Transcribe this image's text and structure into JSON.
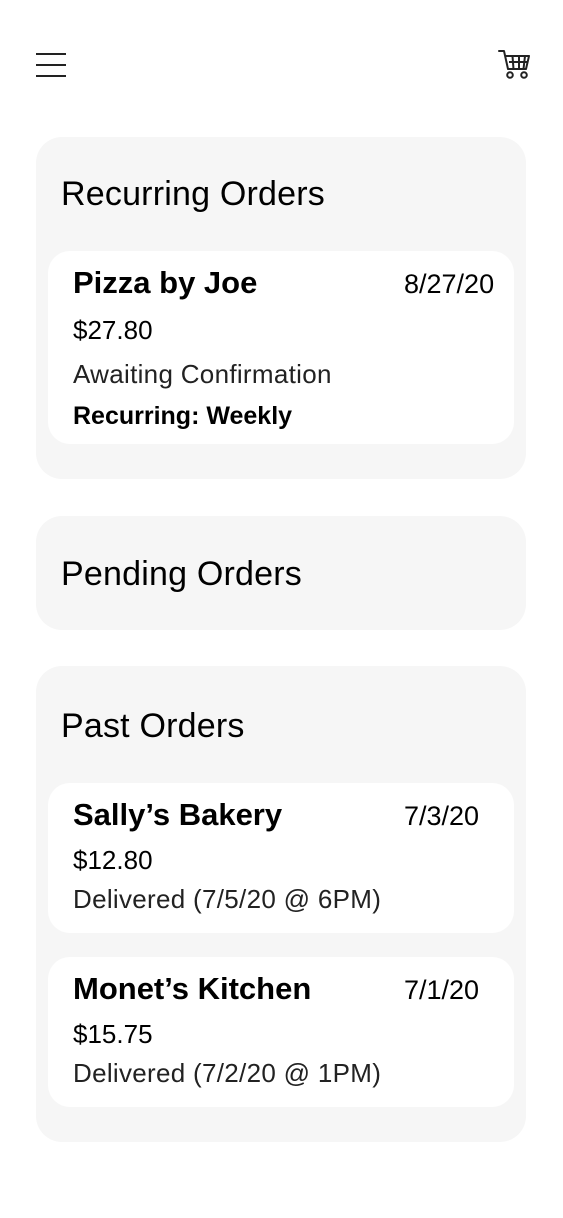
{
  "header": {
    "menu_icon": "hamburger-menu-icon",
    "cart_icon": "shopping-cart-icon"
  },
  "recurring": {
    "title": "Recurring Orders",
    "orders": [
      {
        "name": "Pizza by Joe",
        "date": "8/27/20",
        "price": "$27.80",
        "status": "Awaiting Confirmation",
        "recurrence": "Recurring: Weekly"
      }
    ]
  },
  "pending": {
    "title": "Pending Orders"
  },
  "past": {
    "title": "Past Orders",
    "orders": [
      {
        "name": "Sally’s Bakery",
        "date": "7/3/20",
        "price": "$12.80",
        "status": "Delivered (7/5/20 @ 6PM)"
      },
      {
        "name": "Monet’s Kitchen",
        "date": "7/1/20",
        "price": "$15.75",
        "status": "Delivered (7/2/20 @ 1PM)"
      }
    ]
  }
}
